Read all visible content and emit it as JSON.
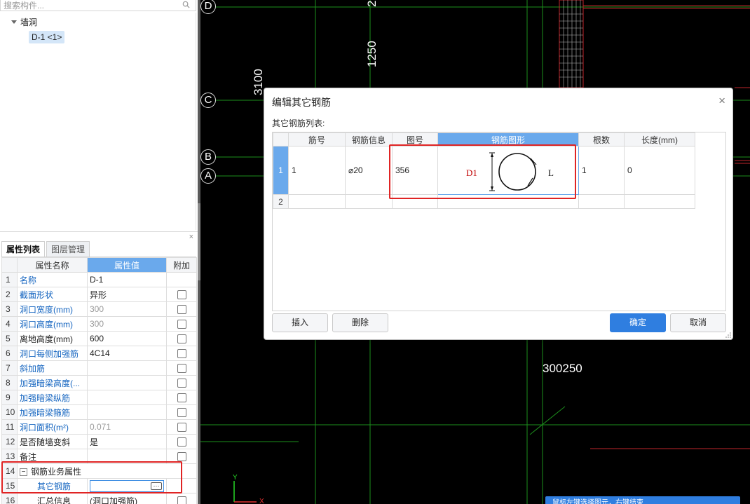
{
  "search": {
    "placeholder": "搜索构件..."
  },
  "tree": {
    "root_label": "墙洞",
    "leaf_label": "D-1 <1>"
  },
  "panel": {
    "close_glyph": "×",
    "tabs": [
      "属性列表",
      "图层管理"
    ],
    "headers": {
      "name": "属性名称",
      "value": "属性值",
      "extra": "附加"
    },
    "rows": [
      {
        "num": "1",
        "name": "名称",
        "value": "D-1",
        "blue": true,
        "gray_value": false,
        "checkbox": false
      },
      {
        "num": "2",
        "name": "截面形状",
        "value": "异形",
        "blue": true,
        "gray_value": false,
        "checkbox": true
      },
      {
        "num": "3",
        "name": "洞口宽度(mm)",
        "value": "300",
        "blue": true,
        "gray_value": true,
        "checkbox": true
      },
      {
        "num": "4",
        "name": "洞口高度(mm)",
        "value": "300",
        "blue": true,
        "gray_value": true,
        "checkbox": true
      },
      {
        "num": "5",
        "name": "离地高度(mm)",
        "value": "600",
        "blue": false,
        "gray_value": false,
        "checkbox": true
      },
      {
        "num": "6",
        "name": "洞口每侧加强筋",
        "value": "4C14",
        "blue": true,
        "gray_value": false,
        "checkbox": true
      },
      {
        "num": "7",
        "name": "斜加筋",
        "value": "",
        "blue": true,
        "gray_value": false,
        "checkbox": true
      },
      {
        "num": "8",
        "name": "加强暗梁高度(...",
        "value": "",
        "blue": true,
        "gray_value": false,
        "checkbox": true
      },
      {
        "num": "9",
        "name": "加强暗梁纵筋",
        "value": "",
        "blue": true,
        "gray_value": false,
        "checkbox": true
      },
      {
        "num": "10",
        "name": "加强暗梁箍筋",
        "value": "",
        "blue": true,
        "gray_value": false,
        "checkbox": true
      },
      {
        "num": "11",
        "name": "洞口面积(m²)",
        "value": "0.071",
        "blue": true,
        "gray_value": true,
        "checkbox": true
      },
      {
        "num": "12",
        "name": "是否随墙变斜",
        "value": "是",
        "blue": false,
        "gray_value": false,
        "checkbox": true
      },
      {
        "num": "13",
        "name": "备注",
        "value": "",
        "blue": false,
        "gray_value": false,
        "checkbox": true
      }
    ],
    "group_row": {
      "num": "14",
      "expander": "−",
      "label": "钢筋业务属性"
    },
    "active_row": {
      "num": "15",
      "name": "其它钢筋",
      "button": "···"
    },
    "last_row": {
      "num": "16",
      "name": "汇总信息",
      "value": "(洞口加强筋)"
    }
  },
  "cad": {
    "axes": [
      "D",
      "C",
      "B",
      "A"
    ],
    "dims_vertical": [
      "2",
      "1250",
      "3100"
    ],
    "dim_horizontal": "300250",
    "ucs_y": "Y",
    "ucs_x": "X",
    "hint_text": "鼠标左键选择图元，右键结束"
  },
  "dialog": {
    "title": "编辑其它钢筋",
    "close_glyph": "×",
    "subtitle": "其它钢筋列表:",
    "columns": [
      "筋号",
      "钢筋信息",
      "图号",
      "钢筋图形",
      "根数",
      "长度(mm)"
    ],
    "rows": [
      {
        "rn": "1",
        "jin": "1",
        "info": "⌀20",
        "tuhao": "356",
        "shape_d": "D1",
        "shape_l": "L",
        "count": "1",
        "length": "0"
      },
      {
        "rn": "2",
        "jin": "",
        "info": "",
        "tuhao": "",
        "shape_d": "",
        "shape_l": "",
        "count": "",
        "length": ""
      }
    ],
    "buttons": {
      "insert": "插入",
      "delete": "删除",
      "ok": "确定",
      "cancel": "取消"
    }
  },
  "colors": {
    "accent": "#2f7ee0",
    "highlight_header": "#6aa9ec",
    "annotation_red": "#e02424",
    "cad_grid_green": "#1d8f1d",
    "cad_red": "#c0262c"
  }
}
